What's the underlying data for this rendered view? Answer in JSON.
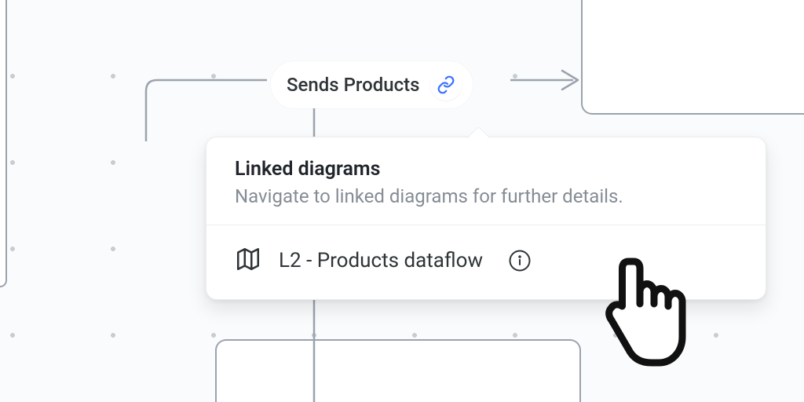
{
  "edge": {
    "label": "Sends Products",
    "icon": "link-icon"
  },
  "popover": {
    "title": "Linked diagrams",
    "subtitle": "Navigate to linked diagrams for further details.",
    "items": [
      {
        "icon": "map-icon",
        "label": "L2 - Products dataflow",
        "info_icon": "info-icon"
      }
    ]
  },
  "colors": {
    "line": "#9aa3ad",
    "link_accent": "#3a72ff",
    "text_primary": "#2f3437",
    "text_secondary": "#858c94"
  }
}
